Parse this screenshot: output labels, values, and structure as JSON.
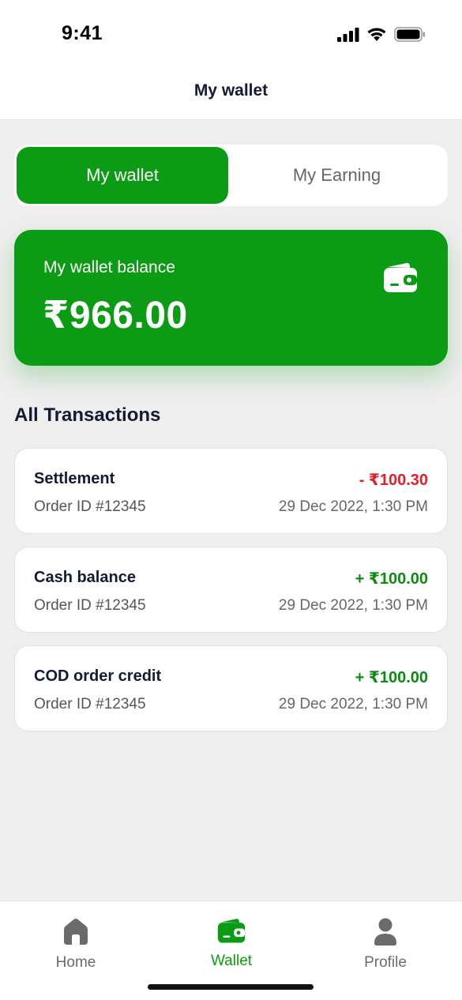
{
  "status_bar": {
    "time": "9:41"
  },
  "header": {
    "title": "My wallet"
  },
  "tabs": [
    {
      "label": "My wallet",
      "active": true
    },
    {
      "label": "My Earning",
      "active": false
    }
  ],
  "balance_card": {
    "label": "My wallet balance",
    "amount": "₹966.00",
    "icon": "wallet-icon"
  },
  "transactions": {
    "title": "All Transactions",
    "items": [
      {
        "title": "Settlement",
        "amount": "- ₹100.30",
        "type": "debit",
        "order": "Order ID #12345",
        "date": "29 Dec 2022, 1:30 PM"
      },
      {
        "title": "Cash balance",
        "amount": "+ ₹100.00",
        "type": "credit",
        "order": "Order ID #12345",
        "date": "29 Dec 2022, 1:30 PM"
      },
      {
        "title": "COD order credit",
        "amount": "+ ₹100.00",
        "type": "credit",
        "order": "Order ID #12345",
        "date": "29 Dec 2022, 1:30 PM"
      }
    ]
  },
  "bottom_nav": [
    {
      "label": "Home",
      "icon": "home-icon",
      "active": false
    },
    {
      "label": "Wallet",
      "icon": "wallet-icon",
      "active": true
    },
    {
      "label": "Profile",
      "icon": "profile-icon",
      "active": false
    }
  ],
  "colors": {
    "accent": "#0c9b14",
    "debit": "#e0212b",
    "credit": "#0c8a12",
    "text_primary": "#141a33",
    "background": "#eeeeee"
  }
}
